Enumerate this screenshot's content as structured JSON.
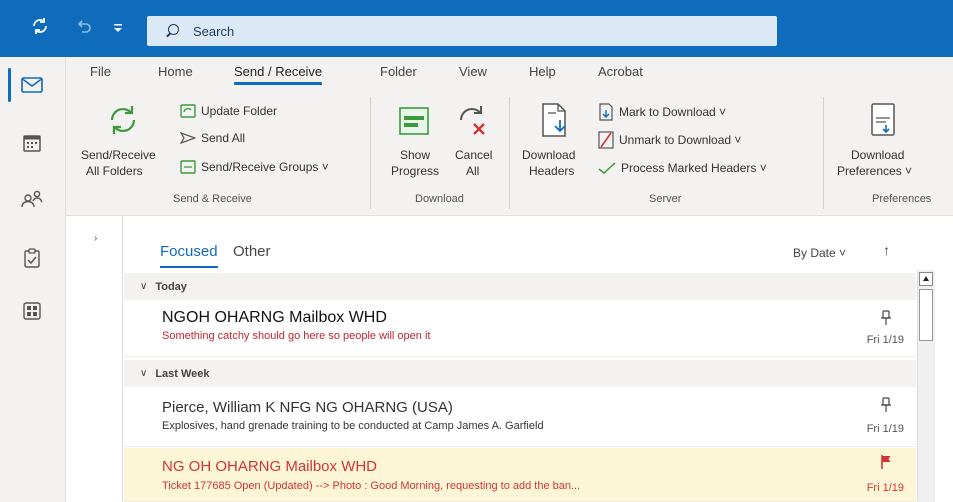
{
  "search": {
    "placeholder": "Search"
  },
  "tabs": [
    "File",
    "Home",
    "Send / Receive",
    "Folder",
    "View",
    "Help",
    "Acrobat"
  ],
  "ribbon": {
    "send_receive": {
      "big_label_1": "Send/Receive",
      "big_label_2": "All Folders",
      "update_folder": "Update Folder",
      "send_all": "Send All",
      "groups": "Send/Receive Groups ˅",
      "group_label": "Send & Receive"
    },
    "download": {
      "show_1": "Show",
      "show_2": "Progress",
      "cancel_1": "Cancel",
      "cancel_2": "All",
      "group_label": "Download"
    },
    "server": {
      "dl_headers_1": "Download",
      "dl_headers_2": "Headers",
      "mark_download": "Mark to Download  ˅",
      "unmark_download": "Unmark to Download  ˅",
      "process_headers": "Process Marked Headers  ˅",
      "group_label": "Server"
    },
    "preferences": {
      "dl_prefs_1": "Download",
      "dl_prefs_2": "Preferences ˅",
      "group_label": "Preferences"
    }
  },
  "mail_list": {
    "tab_focused": "Focused",
    "tab_other": "Other",
    "sort_label": "By Date ˅",
    "sort_arrow": "↑",
    "groups": [
      {
        "label": "Today"
      },
      {
        "label": "Last Week"
      }
    ],
    "messages": [
      {
        "sender": "NGOH OHARNG Mailbox WHD",
        "preview": "Something catchy should go here so people will open it",
        "date": "Fri 1/19",
        "icon": "pin-icon"
      },
      {
        "sender": "Pierce, William K NFG NG OHARNG (USA)",
        "preview": "Explosives, hand grenade training to be conducted  at Camp James A. Garfield",
        "date": "Fri 1/19",
        "icon": "pin-icon"
      },
      {
        "sender": "NG OH OHARNG Mailbox WHD",
        "preview": "Ticket 177685 Open (Updated) --> Photo : Good Morning, requesting to add the ban...",
        "date": "Fri 1/19",
        "icon": "flag-icon"
      }
    ]
  },
  "colors": {
    "accent": "#0f6cbd",
    "flagged_bg": "#fdf6d6",
    "flagged_text": "#d13438",
    "preview_red": "#c4262e"
  }
}
